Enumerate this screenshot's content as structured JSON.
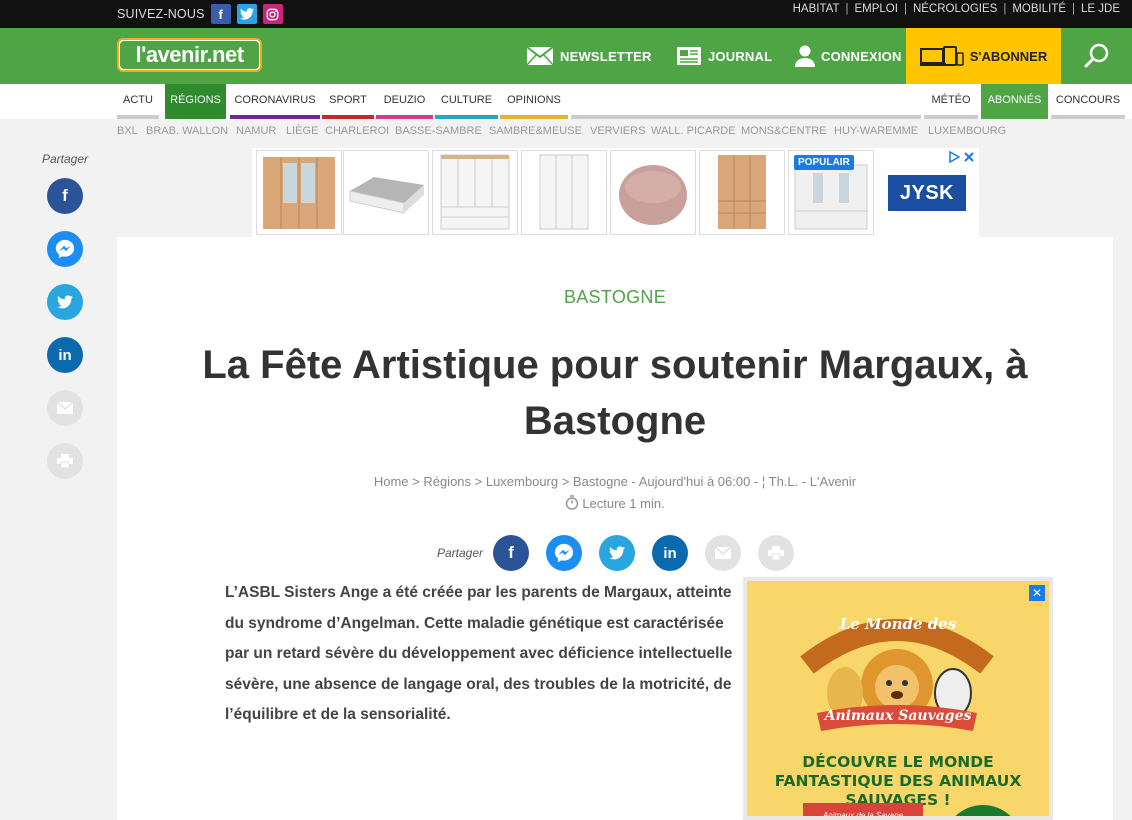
{
  "topbar": {
    "follow_label": "SUIVEZ-NOUS",
    "links": [
      "HABITAT",
      "EMPLOI",
      "NÉCROLOGIES",
      "MOBILITÉ",
      "LE JDE"
    ]
  },
  "header": {
    "logo_text": "l'avenir.net",
    "newsletter": "NEWSLETTER",
    "journal": "JOURNAL",
    "connexion": "CONNEXION",
    "subscribe": "S'ABONNER"
  },
  "categories": {
    "items": [
      "ACTU",
      "RÉGIONS",
      "CORONAVIRUS",
      "SPORT",
      "DEUZIO",
      "CULTURE",
      "OPINIONS"
    ],
    "right": [
      "MÉTÉO",
      "ABONNÉS",
      "CONCOURS"
    ],
    "active": "RÉGIONS"
  },
  "regions": [
    "BXL",
    "BRAB. WALLON",
    "NAMUR",
    "LIÈGE",
    "CHARLEROI",
    "BASSE-SAMBRE",
    "SAMBRE&MEUSE",
    "VERVIERS",
    "WALL. PICARDE",
    "MONS&CENTRE",
    "HUY-WAREMME",
    "LUXEMBOURG"
  ],
  "share": {
    "label": "Partager",
    "icons": [
      "facebook-icon",
      "messenger-icon",
      "twitter-icon",
      "linkedin-icon",
      "mail-icon",
      "print-icon"
    ]
  },
  "ad_top": {
    "popular_badge": "POPULAIR",
    "brand": "JYSK"
  },
  "article": {
    "kicker": "BASTOGNE",
    "title": "La Fête Artistique pour soutenir Margaux, à Bastogne",
    "meta": "Home > Régions > Luxembourg > Bastogne - Aujourd'hui à 06:00 - ¦ Th.L. - L'Avenir",
    "read_time": "Lecture 1 min.",
    "body": "L’ASBL Sisters Ange a été créée par les parents de Margaux, atteinte du syndrome d’Angelman. Cette maladie génétique est caractérisée par un retard sévère du développement avec déficience intellectuelle sévère, une absence de langage oral, des troubles de la motricité, de l’équilibre et de la sensorialité."
  },
  "ad_right": {
    "logo_line1": "Le Monde des",
    "logo_line2": "Animaux Sauvages",
    "headline": "DÉCOUVRE LE MONDE FANTASTIQUE DES ANIMAUX SAUVAGES !",
    "book_title": "Animaux de la Savane"
  },
  "colors": {
    "brand_green": "#4fa545",
    "subscribe_yellow": "#ffc600",
    "facebook": "#2b5397",
    "messenger": "#1c8ef2",
    "twitter": "#29a5e0",
    "linkedin": "#0a6aad",
    "disabled": "#e2e2e2"
  }
}
